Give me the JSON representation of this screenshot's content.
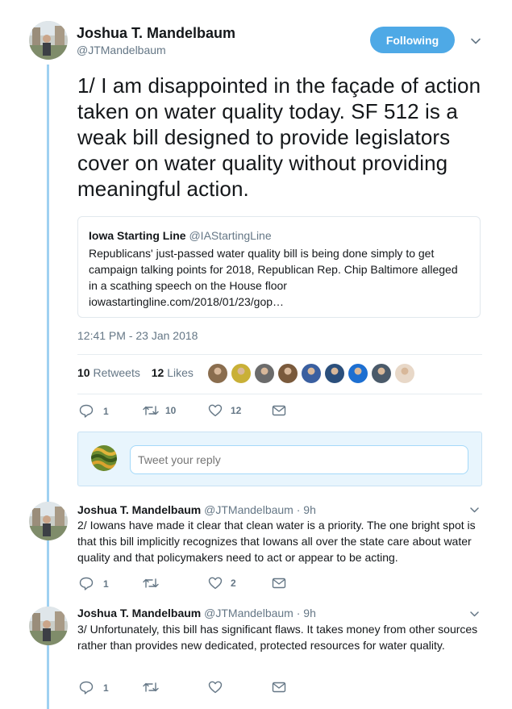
{
  "main_tweet": {
    "name": "Joshua T. Mandelbaum",
    "handle": "@JTMandelbaum",
    "follow_label": "Following",
    "text": "1/ I am disappointed in the façade of action taken on water quality today. SF 512 is a weak bill designed to provide legislators cover on water quality without providing meaningful action.",
    "quote": {
      "name": "Iowa Starting Line",
      "handle": "@IAStartingLine",
      "text": "Republicans' just-passed water quality bill is being done simply to get campaign talking points for 2018, Republican Rep. Chip Baltimore alleged in a scathing speech on the House floor iowastartingline.com/2018/01/23/gop…"
    },
    "timestamp": "12:41 PM - 23 Jan 2018",
    "retweets_count": "10",
    "retweets_label": "Retweets",
    "likes_count": "12",
    "likes_label": "Likes",
    "actions": {
      "replies": "1",
      "retweets": "10",
      "likes": "12"
    },
    "liker_avatar_colors": [
      "#8a6d4e",
      "#c9b037",
      "#6b6b6b",
      "#7a5a3c",
      "#3a5fa0",
      "#2b4f7c",
      "#1d6fd1",
      "#4a5a6a",
      "#e8d8c8"
    ]
  },
  "reply_box": {
    "placeholder": "Tweet your reply"
  },
  "replies": [
    {
      "name": "Joshua T. Mandelbaum",
      "meta": "@JTMandelbaum · 9h",
      "text": "2/ Iowans have made it clear that clean water is a priority. The one bright spot is that this bill implicitly recognizes that Iowans all over the state care about water quality and that policymakers need to act or appear to be acting.",
      "actions": {
        "replies": "1",
        "retweets": "",
        "likes": "2"
      }
    },
    {
      "name": "Joshua T. Mandelbaum",
      "meta": "@JTMandelbaum · 9h",
      "text": "3/ Unfortunately, this bill has significant flaws. It takes money from other sources rather than provides new dedicated, protected resources for water quality.",
      "actions": {
        "replies": "1",
        "retweets": "",
        "likes": ""
      }
    }
  ],
  "colors": {
    "accent": "#4ea9e6",
    "thread_line": "#9fd1f1",
    "muted": "#657786"
  }
}
